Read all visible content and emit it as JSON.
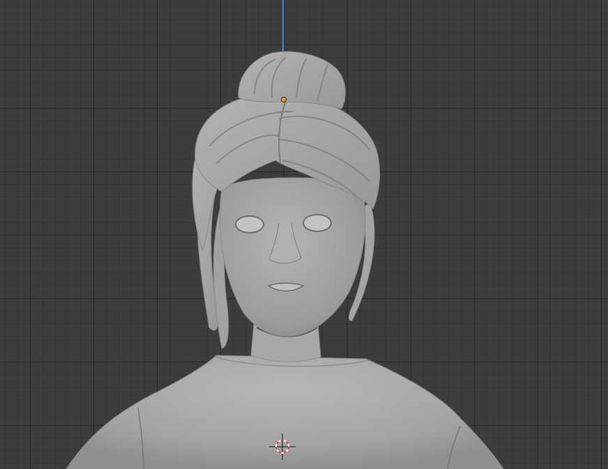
{
  "viewport": {
    "colors": {
      "background": "#3d3d3d",
      "mesh": "#a6a6a6",
      "z_axis": "#4a8fd8",
      "origin": "#f29d26",
      "cursor_red": "#d53a3a"
    },
    "icons": [
      "z-axis-line",
      "object-origin-dot",
      "3d-cursor-icon"
    ]
  }
}
